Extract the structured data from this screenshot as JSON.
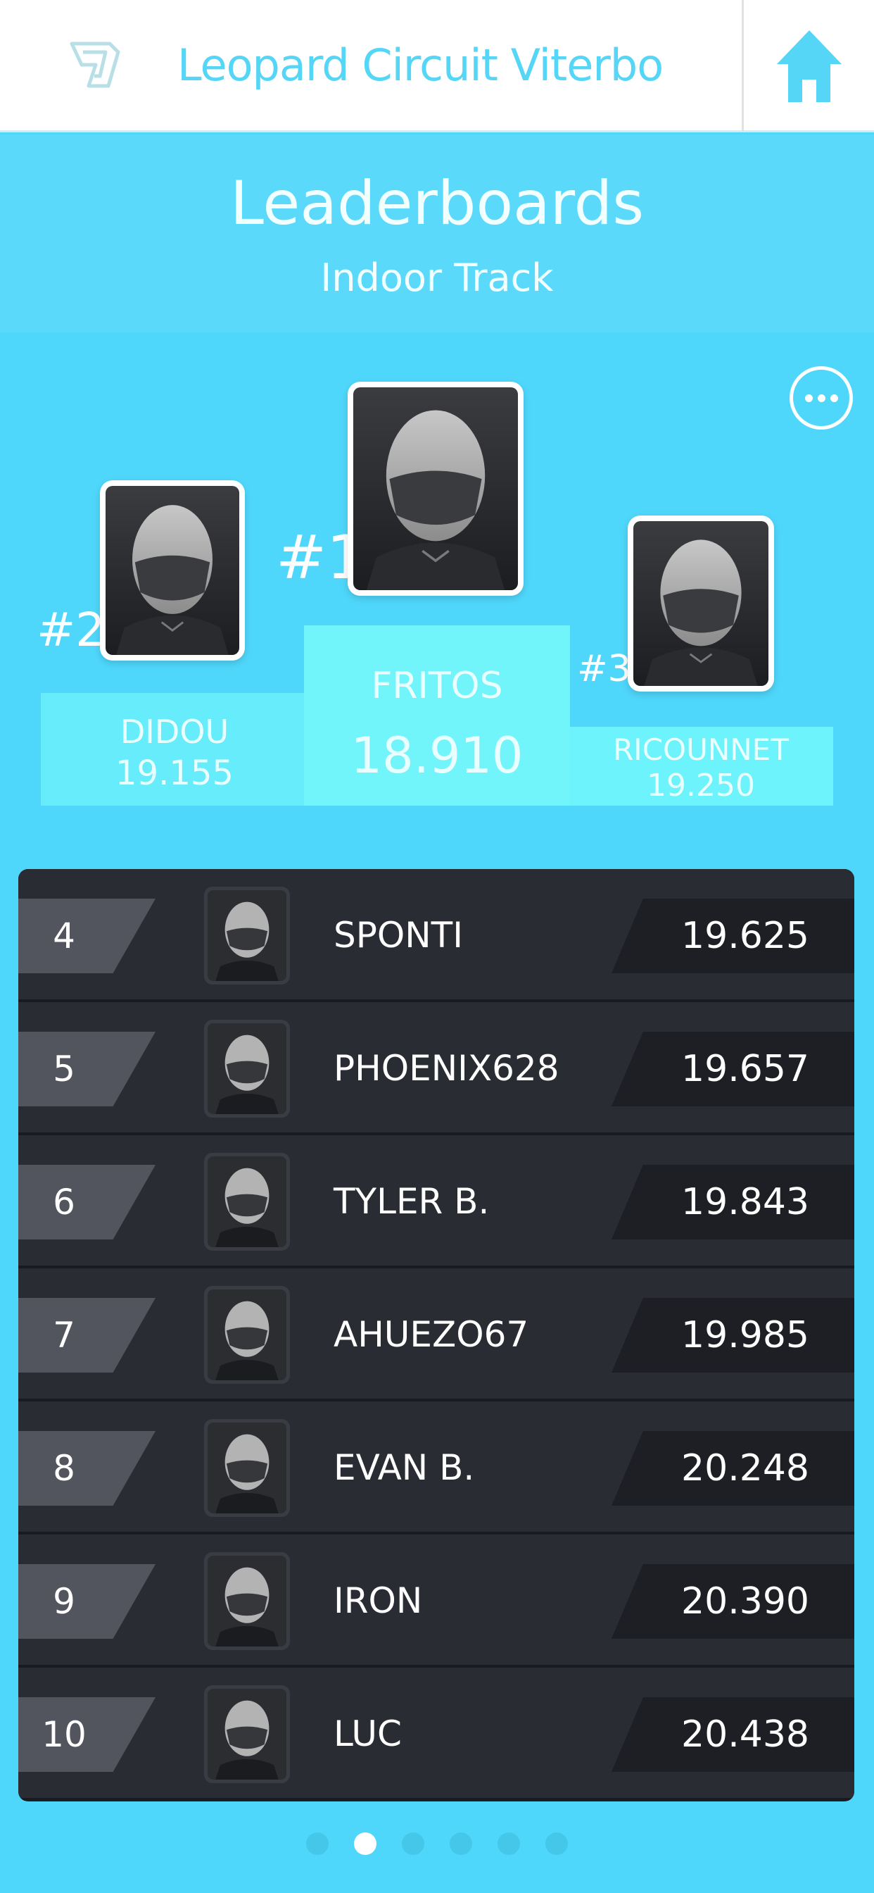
{
  "header": {
    "venue_title": "Leopard Circuit Viterbo",
    "logo_icon": "track-logo-icon",
    "home_icon": "home-icon"
  },
  "leaderboard": {
    "title": "Leaderboards",
    "subtitle": "Indoor Track"
  },
  "podium": {
    "first": {
      "rank": "#1",
      "name": "FRITOS",
      "time": "18.910"
    },
    "second": {
      "rank": "#2",
      "name": "DIDOU",
      "time": "19.155"
    },
    "third": {
      "rank": "#3",
      "name": "RICOUNNET",
      "time": "19.250"
    }
  },
  "rows": [
    {
      "rank": "4",
      "name": "SPONTI",
      "time": "19.625"
    },
    {
      "rank": "5",
      "name": "PHOENIX628",
      "time": "19.657"
    },
    {
      "rank": "6",
      "name": "TYLER B.",
      "time": "19.843"
    },
    {
      "rank": "7",
      "name": "AHUEZO67",
      "time": "19.985"
    },
    {
      "rank": "8",
      "name": "EVAN B.",
      "time": "20.248"
    },
    {
      "rank": "9",
      "name": "IRON",
      "time": "20.390"
    },
    {
      "rank": "10",
      "name": "LUC",
      "time": "20.438"
    }
  ],
  "pager": {
    "pages": 6,
    "active_index": 1
  },
  "colors": {
    "accent": "#55d6f6",
    "background": "#4fd7fb",
    "list_bg": "#2a2c33",
    "podium_block": "#6ff5fb"
  }
}
